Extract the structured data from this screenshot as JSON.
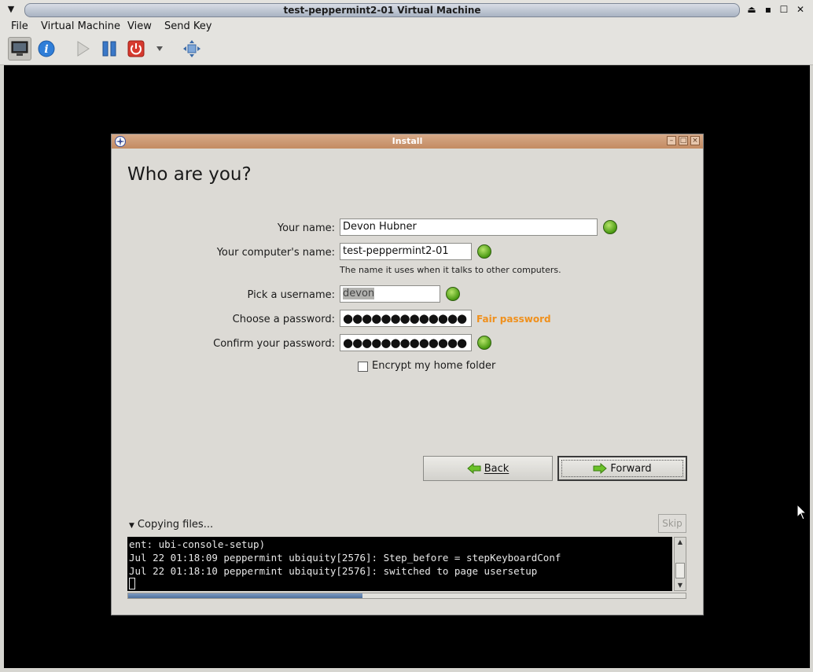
{
  "host": {
    "title": "test-peppermint2-01 Virtual Machine",
    "menu": [
      "File",
      "Virtual Machine",
      "View",
      "Send Key"
    ],
    "toolbar": {
      "icons": [
        "monitor-icon",
        "info-icon",
        "play-icon",
        "pause-icon",
        "power-icon",
        "dropdown-arrow-icon",
        "fullscreen-icon"
      ]
    }
  },
  "installer": {
    "window_title": "Install",
    "heading": "Who are you?",
    "fields": {
      "name_label": "Your name:",
      "name_value": "Devon Hubner",
      "computer_label": "Your computer's name:",
      "computer_value": "test-peppermint2-01",
      "computer_hint": "The name it uses when it talks to other computers.",
      "username_label": "Pick a username:",
      "username_value": "devon",
      "password_label": "Choose a password:",
      "password_value": "●●●●●●●●●●●●●",
      "password_strength": "Fair password",
      "confirm_label": "Confirm your password:",
      "confirm_value": "●●●●●●●●●●●●●"
    },
    "encrypt_label": "Encrypt my home folder",
    "encrypt_checked": false,
    "back_label": "Back",
    "forward_label": "Forward",
    "progress": {
      "label": "Copying files...",
      "skip_label": "Skip",
      "fraction": 0.42
    },
    "console_lines": [
      "ent: ubi-console-setup)",
      "Jul 22 01:18:09 peppermint ubiquity[2576]: Step_before = stepKeyboardConf",
      "Jul 22 01:18:10 peppermint ubiquity[2576]: switched to page usersetup"
    ]
  },
  "colors": {
    "title_accent": "#c48b62",
    "ok_green": "#4a9a12",
    "strength_fair": "#f0901c"
  }
}
